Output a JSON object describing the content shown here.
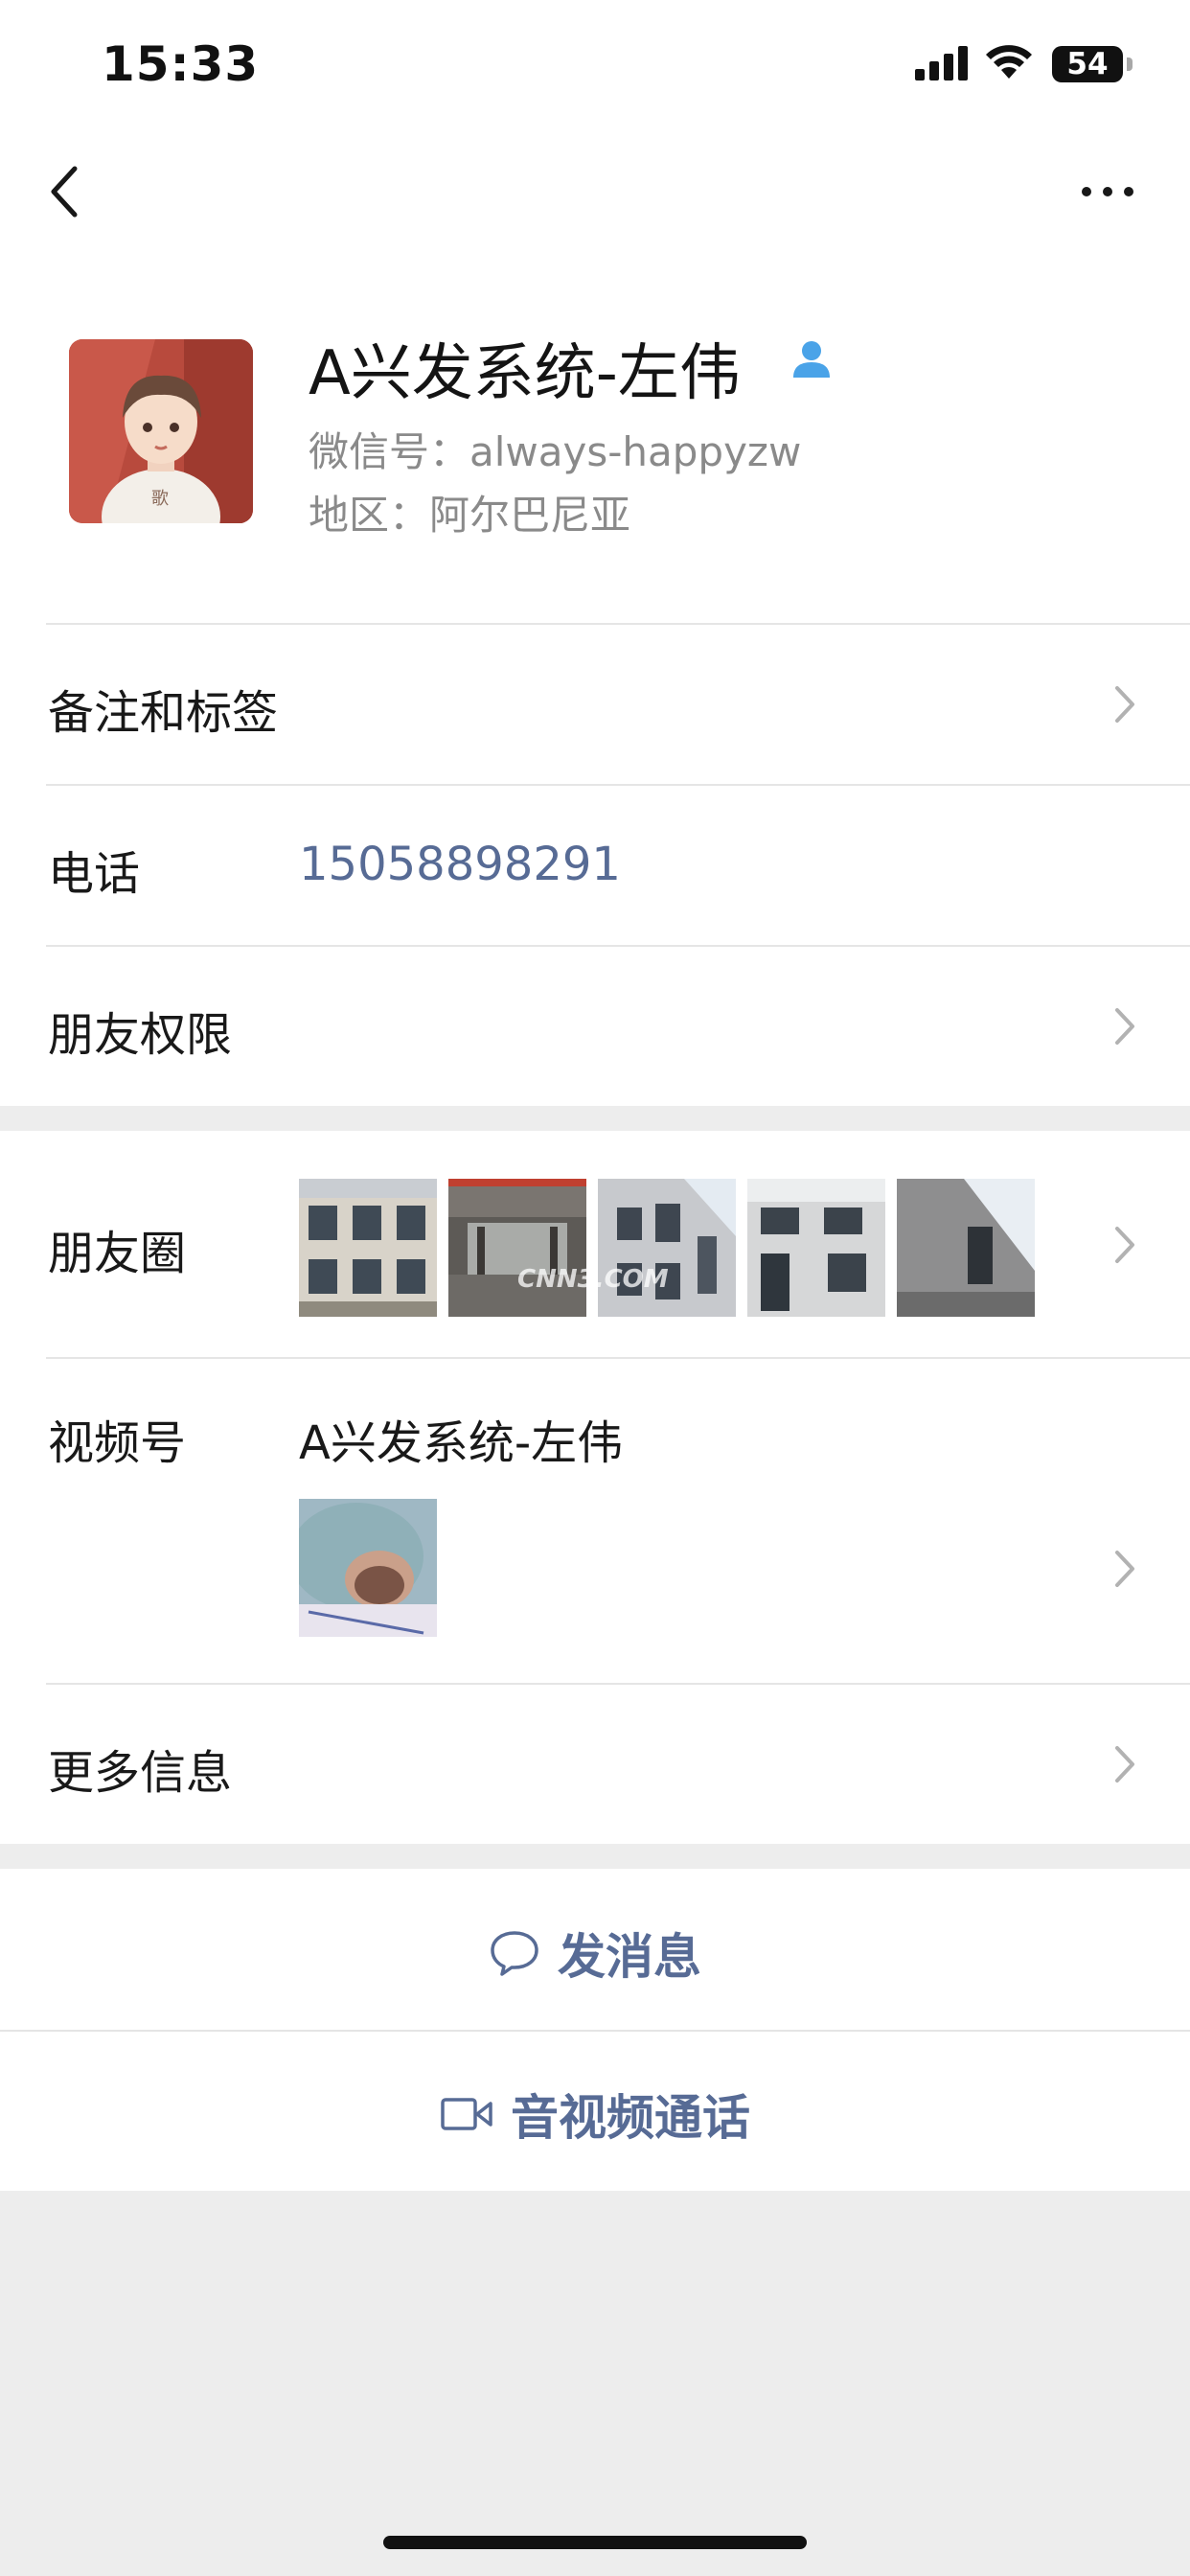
{
  "status_bar": {
    "time": "15:33",
    "battery": "54"
  },
  "nav": {
    "back_icon": "chevron-left-icon",
    "more_icon": "ellipsis-icon"
  },
  "profile": {
    "name": "A兴发系统-左伟",
    "wechat_id": "微信号：always-happyzw",
    "region": "地区：阿尔巴尼亚",
    "avatar_badge": "歌"
  },
  "rows": {
    "remarks_label": "备注和标签",
    "phone_label": "电话",
    "phone_value": "15058898291",
    "permissions_label": "朋友权限",
    "moments_label": "朋友圈",
    "moments_watermark": "CNN3.COM",
    "channels_label": "视频号",
    "channels_name": "A兴发系统-左伟",
    "more_info_label": "更多信息"
  },
  "actions": {
    "message_label": "发消息",
    "call_label": "音视频通话"
  },
  "colors": {
    "link": "#576b95",
    "background": "#ededed",
    "separator": "#e5e5e5"
  }
}
